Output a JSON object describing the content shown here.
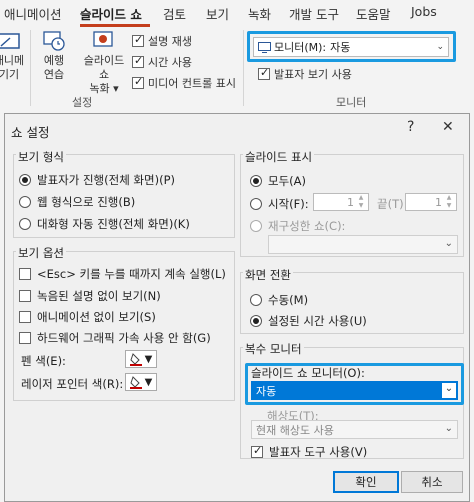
{
  "ribbon": {
    "tabs": [
      "애니메이션",
      "슬라이드 쇼",
      "검토",
      "보기",
      "녹화",
      "개발 도구",
      "도움말",
      "Jobs"
    ],
    "active_tab": "슬라이드 쇼",
    "buttons": {
      "anim": [
        "애니메",
        "기기"
      ],
      "rehearse": [
        "예행",
        "연습"
      ],
      "record": [
        "슬라이드 쇼",
        "녹화 ▾"
      ]
    },
    "checks": {
      "narration": "설명 재생",
      "timings": "시간 사용",
      "media_controls": "미디어 컨트롤 표시"
    },
    "group_setup": "설정",
    "monitor_label": "모니터(M):",
    "monitor_value": "자동",
    "presenter_view": "발표자 보기 사용",
    "group_monitors": "모니터"
  },
  "dialog": {
    "title": "쇼 설정",
    "help": "?",
    "close": "✕",
    "show_type": {
      "title": "보기 형식",
      "options": [
        "발표자가 진행(전체 화면)(P)",
        "웹 형식으로 진행(B)",
        "대화형 자동 진행(전체 화면)(K)"
      ]
    },
    "show_options": {
      "title": "보기 옵션",
      "items": [
        "<Esc> 키를 누를 때까지 계속 실행(L)",
        "녹음된 설명 없이 보기(N)",
        "애니메이션 없이 보기(S)",
        "하드웨어 그래픽 가속 사용 안 함(G)"
      ],
      "pen_color": "펜 색(E):",
      "laser_color": "레이저 포인터 색(R):"
    },
    "show_slides": {
      "title": "슬라이드 표시",
      "all": "모두(A)",
      "from": "시작(F):",
      "from_value": "1",
      "to": "끝(T):",
      "to_value": "1",
      "custom": "재구성한 쇼(C):"
    },
    "advance": {
      "title": "화면 전환",
      "manual": "수동(M)",
      "timings": "설정된 시간 사용(U)"
    },
    "multi_monitor": {
      "title": "복수 모니터",
      "monitor_label": "슬라이드 쇼 모니터(O):",
      "monitor_value": "자동",
      "resolution_label": "해상도(T):",
      "resolution_value": "현재 해상도 사용",
      "presenter_view": "발표자 도구 사용(V)"
    },
    "ok": "확인",
    "cancel": "취소"
  },
  "colors": {
    "accent_tab": "#c43e1c",
    "highlight": "#1a9ae0",
    "selection": "#0078d7"
  }
}
